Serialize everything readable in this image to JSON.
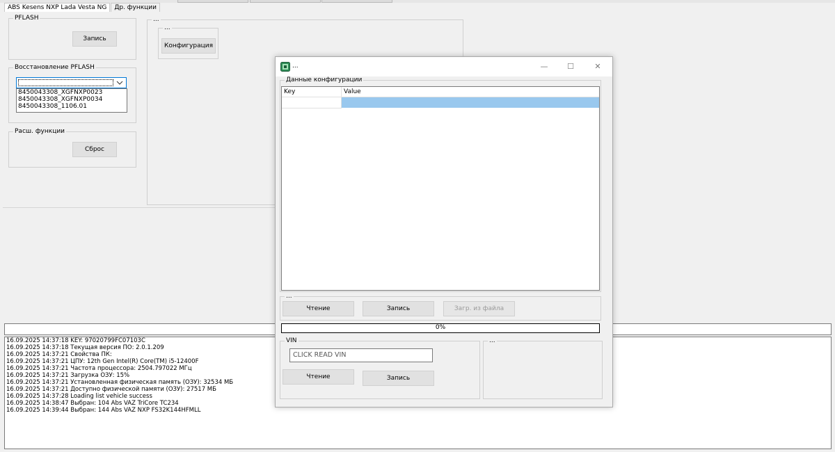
{
  "tabs": [
    {
      "label": "ABS Kesens NXP Lada Vesta NG"
    },
    {
      "label": "Др. функции"
    }
  ],
  "pflash": {
    "legend": "PFLASH",
    "write_button": "Запись"
  },
  "restore": {
    "legend": "Восстановление PFLASH",
    "combo_value": "",
    "options": [
      "8450043308_XGFNXP0023",
      "8450043308_XGFNXP0034",
      "8450043308_1106.01"
    ]
  },
  "ext": {
    "legend": "Расш. функции",
    "reset_button": "Сброс"
  },
  "right_group": {
    "legend": "...",
    "inner_legend": "...",
    "config_button": "Конфигурация"
  },
  "dialog": {
    "title": "...",
    "minimize_glyph": "—",
    "maximize_glyph": "☐",
    "close_glyph": "✕",
    "config_group": "Данные конфигурации",
    "columns": [
      "Key",
      "Value"
    ],
    "ops_legend": "...",
    "read_button": "Чтение",
    "write_button": "Запись",
    "load_button": "Загр. из файла",
    "progress_text": "0%",
    "progress": 0,
    "vin_legend": "VIN",
    "vin_value": "CLICK READ VIN",
    "vin_read_button": "Чтение",
    "vin_write_button": "Запись",
    "right_legend": "..."
  },
  "log": [
    "16.09.2025 14:37:18 KEY: 97020799FC07103C",
    "16.09.2025 14:37:18 Текущая версия ПО: 2.0.1.209",
    "16.09.2025 14:37:21 Свойства ПК:",
    "16.09.2025 14:37:21 ЦПУ: 12th Gen Intel(R) Core(TM) i5-12400F",
    "16.09.2025 14:37:21 Частота процессора: 2504.797022 МГц",
    "16.09.2025 14:37:21 Загрузка ОЗУ: 15%",
    "16.09.2025 14:37:21 Установленная физическая память (ОЗУ): 32534 МБ",
    "16.09.2025 14:37:21 Доступно физической памяти (ОЗУ): 27517 МБ",
    "16.09.2025 14:37:28 Loading list vehicle success",
    "16.09.2025 14:38:47 Выбран:   104 Abs VAZ TriCore TC234",
    "16.09.2025 14:39:44 Выбран:   144 Abs VAZ NXP FS32K144HFMLL"
  ],
  "colors": {
    "selection": "#99c8ee",
    "focus_border": "#0078d7",
    "app_icon": "#2e8b57"
  }
}
